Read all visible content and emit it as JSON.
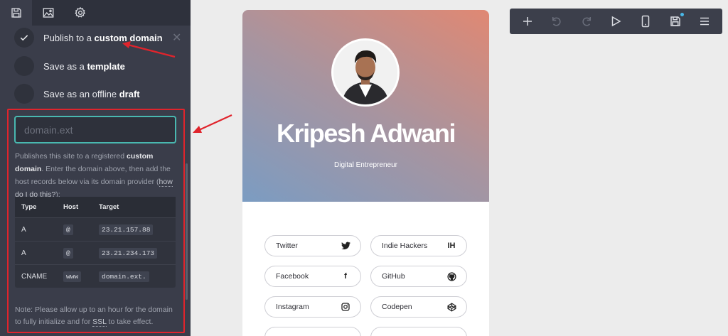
{
  "panel": {
    "tabs": [
      {
        "name": "save-icon"
      },
      {
        "name": "image-icon"
      },
      {
        "name": "gear-icon"
      }
    ],
    "options": [
      {
        "text": "Publish to a ",
        "bold": "custom domain",
        "checked": true
      },
      {
        "text": "Save as a ",
        "bold": "template",
        "checked": false
      },
      {
        "text": "Save as an offline ",
        "bold": "draft",
        "checked": false
      }
    ],
    "domain_input": {
      "value": "",
      "placeholder": "domain.ext"
    },
    "description": {
      "part1": "Publishes this site to a registered ",
      "bold": "custom domain",
      "part2": ". Enter the domain above, then add the host records below via its domain provider (",
      "link": "how do I do this?",
      "part3": "):"
    },
    "records": {
      "headers": [
        "Type",
        "Host",
        "Target"
      ],
      "rows": [
        {
          "type": "A",
          "host": "@",
          "target": "23.21.157.88"
        },
        {
          "type": "A",
          "host": "@",
          "target": "23.21.234.173"
        },
        {
          "type": "CNAME",
          "host": "www",
          "target": "domain.ext."
        }
      ]
    },
    "note": {
      "part1": "Note: Please allow up to an hour for the domain to fully initialize and for ",
      "ssl": "SSL",
      "part2": " to take effect."
    }
  },
  "profile": {
    "name": "Kripesh Adwani",
    "subtitle": "Digital Entrepreneur",
    "links": [
      {
        "label": "Twitter",
        "icon": "twitter-icon"
      },
      {
        "label": "Indie Hackers",
        "icon": "indie-hackers-icon",
        "icon_text": "IH"
      },
      {
        "label": "Facebook",
        "icon": "facebook-icon",
        "icon_text": "f"
      },
      {
        "label": "GitHub",
        "icon": "github-icon"
      },
      {
        "label": "Instagram",
        "icon": "instagram-icon"
      },
      {
        "label": "Codepen",
        "icon": "codepen-icon"
      }
    ],
    "colors": {
      "gradient_start": "#7b9cc2",
      "gradient_end": "#e08873"
    }
  },
  "toolbar": {
    "buttons": [
      "add-icon",
      "undo-icon",
      "redo-icon",
      "play-icon",
      "mobile-icon",
      "save-icon",
      "menu-icon"
    ],
    "accent": "#49b8e8"
  },
  "annotations": {
    "highlight_color": "#e0242c"
  }
}
